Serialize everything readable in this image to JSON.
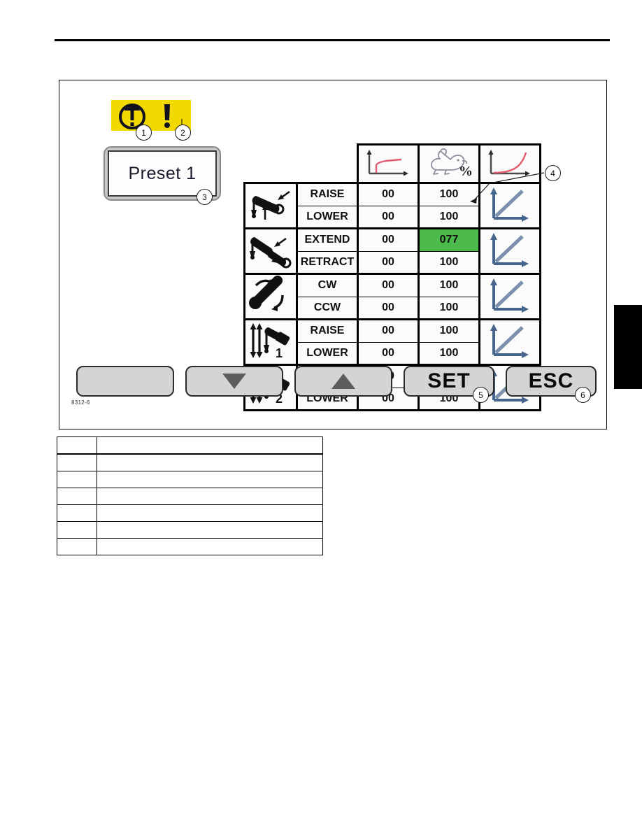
{
  "page": {
    "figure_number": "8312-6"
  },
  "screen": {
    "warning_banner": {
      "lamp_icon": "warning-lamp-icon",
      "exclamation_icon": "exclamation-icon",
      "background_color": "#f2da00"
    },
    "preset_display": {
      "value": "Preset 1"
    },
    "table": {
      "headers": [
        {
          "icon": "ramp-up-start-curve-icon",
          "name": "ramp-start"
        },
        {
          "icon": "rabbit-speed-percent-icon",
          "name": "max-speed-percent",
          "unit": "%"
        },
        {
          "icon": "ramp-down-end-curve-icon",
          "name": "ramp-end"
        }
      ],
      "rows": [
        {
          "function_icon": "boom-lift-icon",
          "directions": [
            {
              "label": "RAISE",
              "ramp": "00",
              "speed": "100",
              "highlighted": false
            },
            {
              "label": "LOWER",
              "ramp": "00",
              "speed": "100",
              "highlighted": false
            }
          ],
          "curve_icon": "linear-ramp-curve-icon"
        },
        {
          "function_icon": "boom-telescope-icon",
          "directions": [
            {
              "label": "EXTEND",
              "ramp": "00",
              "speed": "077",
              "highlighted": true
            },
            {
              "label": "RETRACT",
              "ramp": "00",
              "speed": "100",
              "highlighted": false
            }
          ],
          "curve_icon": "linear-ramp-curve-icon"
        },
        {
          "function_icon": "swing-rotation-icon",
          "directions": [
            {
              "label": "CW",
              "ramp": "00",
              "speed": "100",
              "highlighted": false
            },
            {
              "label": "CCW",
              "ramp": "00",
              "speed": "100",
              "highlighted": false
            }
          ],
          "curve_icon": "linear-ramp-curve-icon"
        },
        {
          "function_icon": "winch-1-icon",
          "directions": [
            {
              "label": "RAISE",
              "ramp": "00",
              "speed": "100",
              "highlighted": false
            },
            {
              "label": "LOWER",
              "ramp": "00",
              "speed": "100",
              "highlighted": false
            }
          ],
          "curve_icon": "linear-ramp-curve-icon"
        },
        {
          "function_icon": "winch-2-icon",
          "directions": [
            {
              "label": "RAISE",
              "ramp": "00",
              "speed": "100",
              "highlighted": false
            },
            {
              "label": "LOWER",
              "ramp": "00",
              "speed": "100",
              "highlighted": false
            }
          ],
          "curve_icon": "linear-ramp-curve-icon"
        }
      ],
      "highlight_color": "#4cbb4c"
    },
    "softkeys": [
      {
        "label": "",
        "name": "blank-softkey"
      },
      {
        "label": "",
        "name": "scroll-down-softkey",
        "icon": "triangle-down-icon"
      },
      {
        "label": "",
        "name": "scroll-up-softkey",
        "icon": "triangle-up-icon"
      },
      {
        "label": "SET",
        "name": "set-softkey"
      },
      {
        "label": "ESC",
        "name": "esc-softkey"
      }
    ]
  },
  "callouts": [
    {
      "id": "1"
    },
    {
      "id": "2"
    },
    {
      "id": "3"
    },
    {
      "id": "4"
    },
    {
      "id": "5"
    },
    {
      "id": "6"
    }
  ],
  "legend": {
    "rows": [
      {
        "ref": "",
        "desc": ""
      },
      {
        "ref": "",
        "desc": ""
      },
      {
        "ref": "",
        "desc": ""
      },
      {
        "ref": "",
        "desc": ""
      },
      {
        "ref": "",
        "desc": ""
      },
      {
        "ref": "",
        "desc": ""
      },
      {
        "ref": "",
        "desc": ""
      }
    ]
  }
}
